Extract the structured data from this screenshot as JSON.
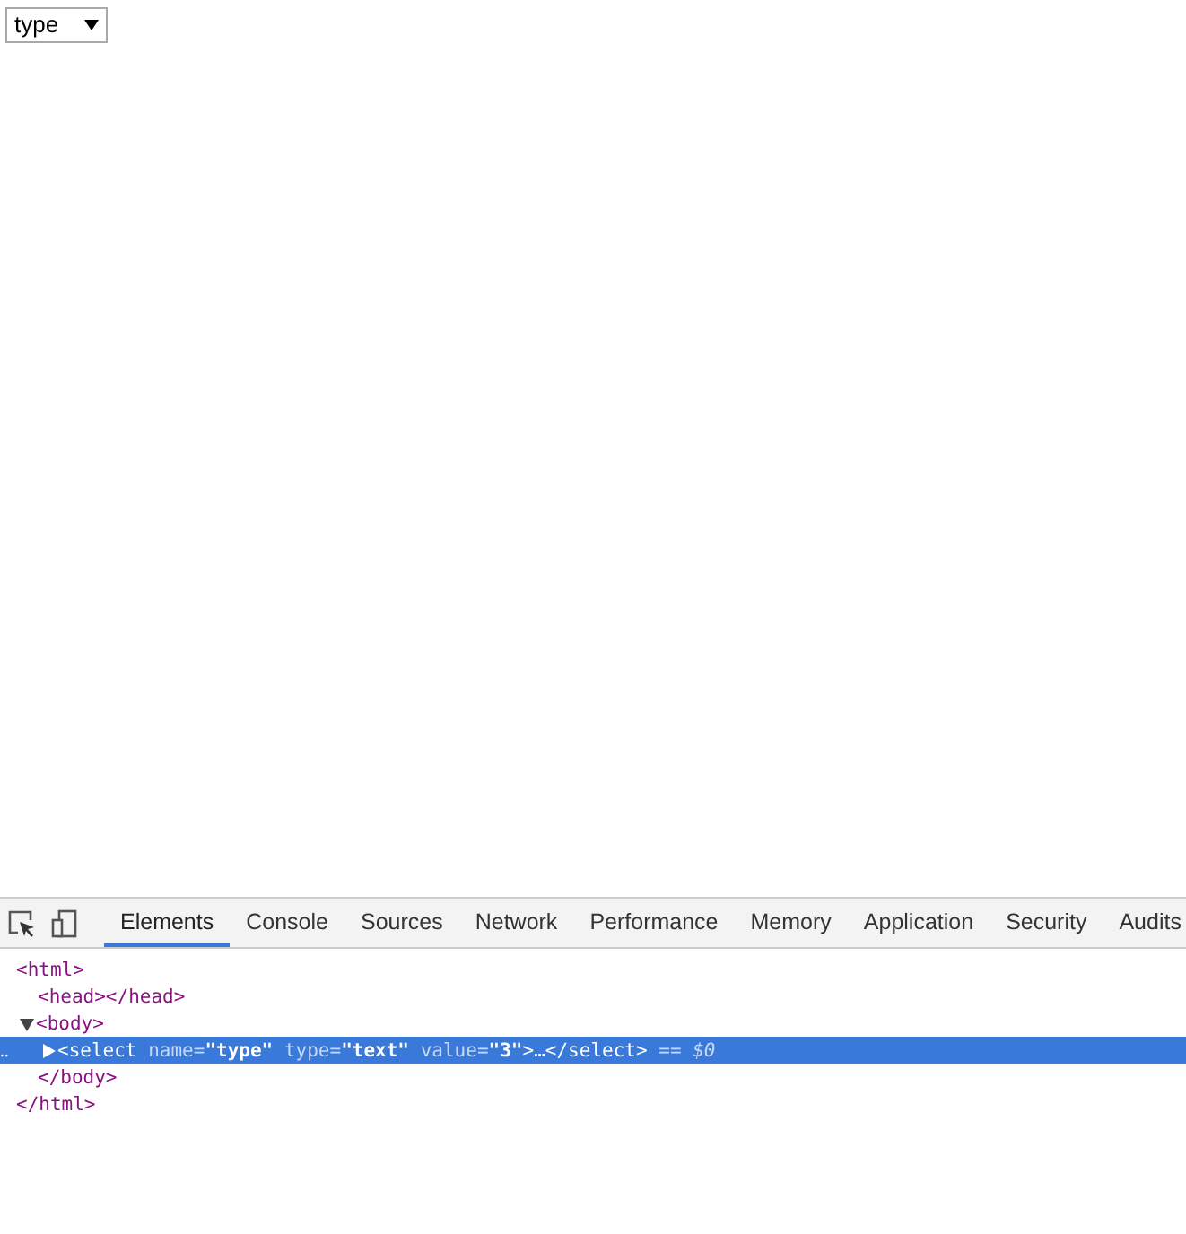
{
  "page": {
    "dropdown": {
      "value": "type"
    }
  },
  "devtools": {
    "tabs": [
      {
        "label": "Elements",
        "selected": true
      },
      {
        "label": "Console",
        "selected": false
      },
      {
        "label": "Sources",
        "selected": false
      },
      {
        "label": "Network",
        "selected": false
      },
      {
        "label": "Performance",
        "selected": false
      },
      {
        "label": "Memory",
        "selected": false
      },
      {
        "label": "Application",
        "selected": false
      },
      {
        "label": "Security",
        "selected": false
      },
      {
        "label": "Audits",
        "selected": false
      }
    ],
    "dom_tree": [
      {
        "selected": false,
        "tokens": [
          {
            "kind": "tag",
            "text": "<html>"
          }
        ],
        "close": [
          {
            "kind": "tag",
            "text": "</html>"
          }
        ],
        "children": [
          {
            "selected": false,
            "tokens": [
              {
                "kind": "tag",
                "text": "<head></head>"
              }
            ]
          },
          {
            "selected": false,
            "expanded": true,
            "tokens": [
              {
                "kind": "tag",
                "text": "<body>"
              }
            ],
            "close": [
              {
                "kind": "tag",
                "text": "</body>"
              }
            ],
            "children": [
              {
                "selected": true,
                "expanded": false,
                "gutter": "‥",
                "tokens": [
                  {
                    "kind": "tag",
                    "text": "<select"
                  },
                  {
                    "kind": "attr",
                    "text": " name="
                  },
                  {
                    "kind": "value",
                    "text": "\"type\""
                  },
                  {
                    "kind": "attr",
                    "text": " type="
                  },
                  {
                    "kind": "value",
                    "text": "\"text\""
                  },
                  {
                    "kind": "attr",
                    "text": " value="
                  },
                  {
                    "kind": "value",
                    "text": "\"3\""
                  },
                  {
                    "kind": "tag",
                    "text": ">"
                  },
                  {
                    "kind": "text",
                    "text": "…"
                  },
                  {
                    "kind": "tag",
                    "text": "</select>"
                  },
                  {
                    "kind": "ref",
                    "text": " == $0"
                  }
                ]
              }
            ]
          }
        ]
      }
    ]
  }
}
